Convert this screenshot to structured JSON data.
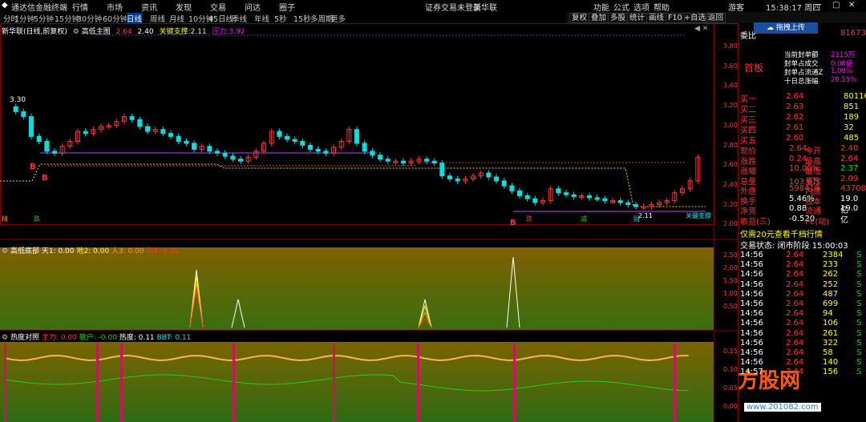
{
  "menu": {
    "brand": "通达信金融终端",
    "items": [
      "行情",
      "市场",
      "资讯",
      "发现",
      "交易",
      "问达",
      "圈子"
    ],
    "status": "证券交易未登录",
    "stock": "新华联",
    "right": [
      "功能",
      "公式",
      "选项",
      "帮助",
      "游客"
    ],
    "time": "15:38:17 周四"
  },
  "periods": [
    "分时",
    "1分钟",
    "5分钟",
    "15分钟",
    "30分钟",
    "60分钟",
    "日线",
    "周线",
    "月线",
    "10分钟",
    "45日线",
    "季线",
    "年线",
    "5秒",
    "15秒",
    "多周期",
    "更多"
  ],
  "toolbar": [
    "复权",
    "叠加",
    "多股",
    "统计",
    "画线",
    "F10",
    "+自选",
    "返回"
  ],
  "main_legend": {
    "title": "新华联(日线,前复权)",
    "indicator": "高低主图",
    "v1": "2.64",
    "v2": "2.40",
    "support_label": "关键支撑:",
    "support": "2.11",
    "pressure_label": "压力:",
    "pressure": "3.92"
  },
  "price_axis": [
    "3.80",
    "3.60",
    "3.40",
    "3.20",
    "3.00",
    "2.80",
    "2.60",
    "2.40",
    "2.20",
    "2.00"
  ],
  "high_mark": "3.30",
  "low_mark": "2.11",
  "support_tag": "关键支撑",
  "signals": {
    "left1": "精",
    "left2": "跌",
    "m1": "跌",
    "m2": "减",
    "m3": "财"
  },
  "b_marks": [
    "B",
    "B",
    "B"
  ],
  "ind1": {
    "name": "高低底部",
    "t1": "天1: 0.00",
    "t2": "地2: 0.00",
    "t3": "人3: 0.00",
    "t4": "和4: 0.00",
    "axis": [
      "2.50",
      "2.00",
      "1.50",
      "1.00",
      "0.50"
    ]
  },
  "ind2": {
    "name": "热度对照",
    "a": "主力: 0.00",
    "b": "散户: -0.00",
    "c": "热度: 0.11",
    "d": "BBT: 0.11",
    "axis": [
      "0.15",
      "0.10",
      "0.05",
      "0.00"
    ]
  },
  "right_panel": {
    "upload": "拖拽上传",
    "weibi_label": "委比",
    "weibi_val": "81673",
    "board": "首板",
    "stats": [
      [
        "当前封单额",
        "2115万"
      ],
      [
        "封单占成交",
        "0.08倍"
      ],
      [
        "封单占流通Z",
        "1.09%"
      ],
      [
        "十日总涨幅",
        "20.55%"
      ]
    ],
    "buys": [
      [
        "买一",
        "2.64",
        "80116"
      ],
      [
        "买二",
        "2.63",
        "851"
      ],
      [
        "买三",
        "2.62",
        "189"
      ],
      [
        "买四",
        "2.61",
        "32"
      ],
      [
        "买五",
        "2.60",
        "485"
      ]
    ],
    "quote": [
      [
        "现价",
        "2.64",
        "今开",
        "2.40"
      ],
      [
        "涨跌",
        "0.24",
        "最高",
        "2.64"
      ],
      [
        "涨幅",
        "10.00%",
        "最低",
        "2.37"
      ],
      [
        "总量",
        "103.6万",
        "量比",
        "2.09"
      ],
      [
        "外盘",
        "598419",
        "内盘",
        "437081"
      ],
      [
        "换手",
        "5.46%",
        "股本",
        "19.0亿"
      ],
      [
        "净资",
        "0.88",
        "流通",
        "19.0亿"
      ],
      [
        "收益(三)",
        "-0.520",
        "PE(动)",
        ""
      ]
    ],
    "promo": "仅需20元查看千档行情",
    "trade_status": "交易状态: 闭市阶段 15:00:03",
    "ticks": [
      [
        "14:56",
        "2.64",
        "2384",
        "S"
      ],
      [
        "14:56",
        "2.64",
        "233",
        "S"
      ],
      [
        "14:56",
        "2.64",
        "262",
        "S"
      ],
      [
        "14:56",
        "2.64",
        "252",
        "S"
      ],
      [
        "14:56",
        "2.64",
        "487",
        "S"
      ],
      [
        "14:56",
        "2.64",
        "699",
        "S"
      ],
      [
        "14:56",
        "2.64",
        "94",
        "S"
      ],
      [
        "14:56",
        "2.64",
        "106",
        "S"
      ],
      [
        "14:56",
        "2.64",
        "261",
        "S"
      ],
      [
        "14:56",
        "2.64",
        "322",
        "S"
      ],
      [
        "14:56",
        "2.64",
        "58",
        "S"
      ],
      [
        "14:56",
        "2.64",
        "140",
        "S"
      ],
      [
        "14:57",
        "2.64",
        "156",
        "S"
      ]
    ]
  },
  "watermark": {
    "logo": "方股网",
    "url": "www.201082.com"
  }
}
